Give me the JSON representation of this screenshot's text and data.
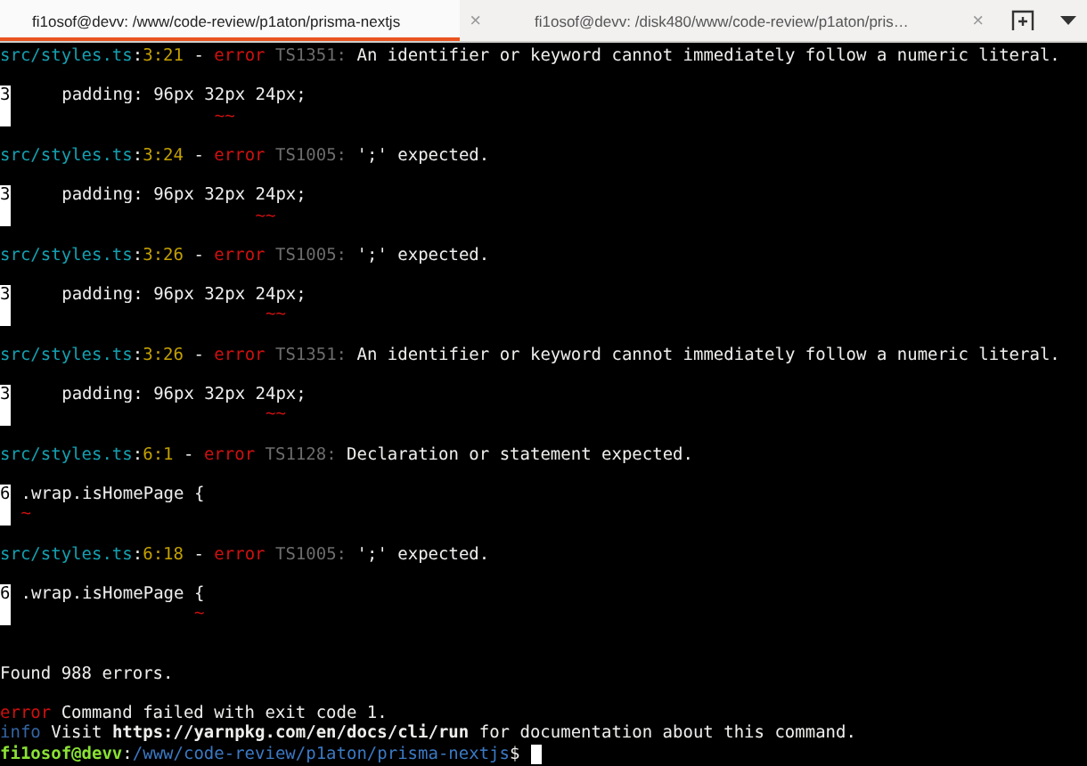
{
  "tabs": [
    {
      "title": "fi1osof@devv: /www/code-review/p1aton/prisma-nextjs",
      "close": "×",
      "selected": true
    },
    {
      "title": "fi1osof@devv: /disk480/www/code-review/p1aton/pris…",
      "close": "×",
      "selected": false
    }
  ],
  "diagnostics": [
    {
      "file": "src/styles.ts",
      "separator": ":",
      "position": "3:21",
      "dash": "-",
      "kind": "error",
      "severity": "error",
      "code": "TS1351:",
      "message": "An identifier or keyword cannot immediately follow a numeric literal.",
      "source": {
        "line_number": "3",
        "code": "     padding: 96px 32px 24px;",
        "marker": "                    ~~"
      }
    },
    {
      "file": "src/styles.ts",
      "separator": ":",
      "position": "3:24",
      "dash": "-",
      "kind": "error",
      "severity": "error",
      "code": "TS1005:",
      "message": "';' expected.",
      "source": {
        "line_number": "3",
        "code": "     padding: 96px 32px 24px;",
        "marker": "                        ~~"
      }
    },
    {
      "file": "src/styles.ts",
      "separator": ":",
      "position": "3:26",
      "dash": "-",
      "kind": "error",
      "severity": "error",
      "code": "TS1005:",
      "message": "';' expected.",
      "source": {
        "line_number": "3",
        "code": "     padding: 96px 32px 24px;",
        "marker": "                         ~~"
      }
    },
    {
      "file": "src/styles.ts",
      "separator": ":",
      "position": "3:26",
      "dash": "-",
      "kind": "error",
      "severity": "error",
      "code": "TS1351:",
      "message": "An identifier or keyword cannot immediately follow a numeric literal.",
      "source": {
        "line_number": "3",
        "code": "     padding: 96px 32px 24px;",
        "marker": "                         ~~"
      }
    },
    {
      "file": "src/styles.ts",
      "separator": ":",
      "position": "6:1",
      "dash": "-",
      "kind": "error",
      "severity": "error",
      "code": "TS1128:",
      "message": "Declaration or statement expected.",
      "source": {
        "line_number": "6",
        "code": " .wrap.isHomePage {",
        "marker": " ~"
      }
    },
    {
      "file": "src/styles.ts",
      "separator": ":",
      "position": "6:18",
      "dash": "-",
      "kind": "error",
      "severity": "error",
      "code": "TS1005:",
      "message": "';' expected.",
      "source": {
        "line_number": "6",
        "code": " .wrap.isHomePage {",
        "marker": "                  ~"
      }
    }
  ],
  "summary": "Found 988 errors.",
  "messages": [
    {
      "kind": "error",
      "label": "error",
      "text": "Command failed with exit code 1."
    },
    {
      "kind": "info",
      "label": "info",
      "text": "Visit **https://yarnpkg.com/en/docs/cli/run** for documentation about this command."
    }
  ],
  "prompt": {
    "user_host": "fi1osof@devv",
    "separator": ":",
    "path": "/www/code-review/p1aton/prisma-nextjs",
    "symbol": "$"
  }
}
